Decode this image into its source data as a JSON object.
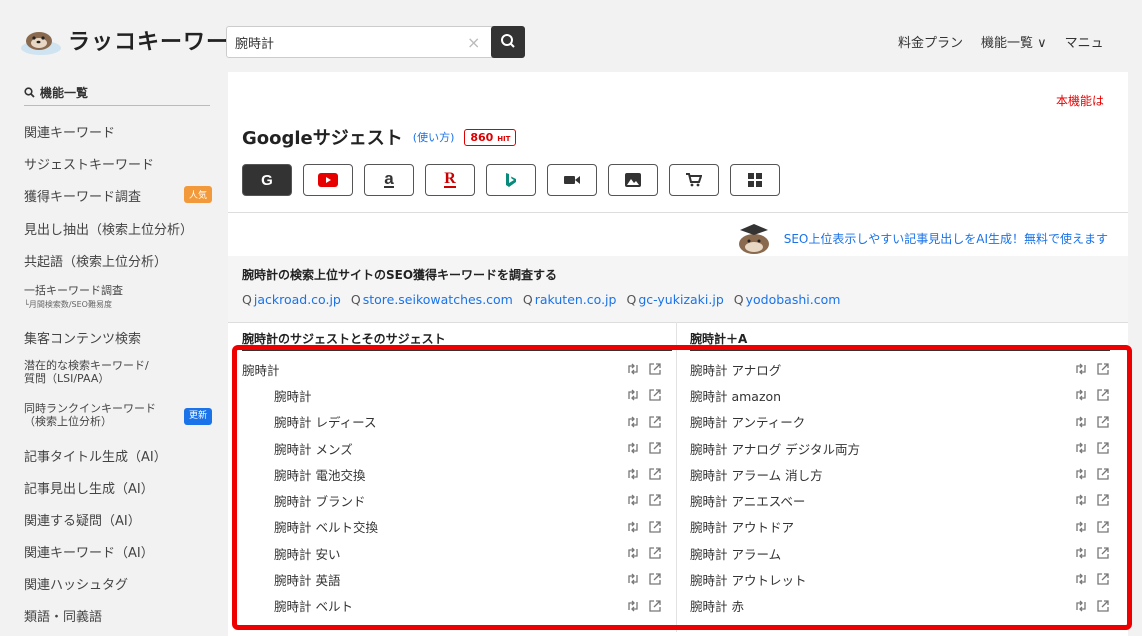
{
  "header": {
    "logo_text": "ラッコキーワード",
    "search_value": "腕時計",
    "nav": [
      "料金プラン",
      "機能一覧 ∨",
      "マニュ"
    ]
  },
  "sidebar": {
    "heading": "機能一覧",
    "items": [
      {
        "label": "関連キーワード"
      },
      {
        "label": "サジェストキーワード"
      },
      {
        "label": "獲得キーワード調査",
        "badge": "人気"
      },
      {
        "label": "見出し抽出（検索上位分析）"
      },
      {
        "label": "共起語（検索上位分析）"
      },
      {
        "label": "一括キーワード調査",
        "sub": "└月間検索数/SEO難易度"
      },
      {
        "label": "集客コンテンツ検索"
      },
      {
        "label": "潜在的な検索キーワード/",
        "sub2": "質問（LSI/PAA）"
      },
      {
        "label": "同時ランクインキーワード",
        "sub2": "（検索上位分析）",
        "badge": "更新"
      },
      {
        "label": "記事タイトル生成（AI）"
      },
      {
        "label": "記事見出し生成（AI）"
      },
      {
        "label": "関連する疑問（AI）"
      },
      {
        "label": "関連キーワード（AI）"
      },
      {
        "label": "関連ハッシュタグ"
      },
      {
        "label": "類語・同義語"
      }
    ]
  },
  "main": {
    "notice": "本機能は",
    "title": "Googleサジェスト",
    "usage_link": "(使い方)",
    "hit_count": "860",
    "hit_unit": "HIT",
    "engines": [
      "G",
      "youtube",
      "a",
      "R",
      "bing",
      "video",
      "image",
      "shopping",
      "windows"
    ],
    "promo_text": "SEO上位表示しやすい記事見出しをAI生成！無料で使えます",
    "seo_title": "腕時計の検索上位サイトのSEO獲得キーワードを調査する",
    "domains": [
      "jackroad.co.jp",
      "store.seikowatches.com",
      "rakuten.co.jp",
      "gc-yukizaki.jp",
      "yodobashi.com"
    ],
    "left_header": "腕時計のサジェストとそのサジェスト",
    "right_header": "腕時計＋A",
    "left_rows": [
      {
        "text": "腕時計",
        "indent": false
      },
      {
        "text": "腕時計",
        "indent": true
      },
      {
        "text": "腕時計 レディース",
        "indent": true
      },
      {
        "text": "腕時計 メンズ",
        "indent": true
      },
      {
        "text": "腕時計 電池交換",
        "indent": true
      },
      {
        "text": "腕時計 ブランド",
        "indent": true
      },
      {
        "text": "腕時計 ベルト交換",
        "indent": true
      },
      {
        "text": "腕時計 安い",
        "indent": true
      },
      {
        "text": "腕時計 英語",
        "indent": true
      },
      {
        "text": "腕時計 ベルト",
        "indent": true
      }
    ],
    "right_rows": [
      "腕時計 アナログ",
      "腕時計 amazon",
      "腕時計 アンティーク",
      "腕時計 アナログ デジタル両方",
      "腕時計 アラーム 消し方",
      "腕時計 アニエスベー",
      "腕時計 アウトドア",
      "腕時計 アラーム",
      "腕時計 アウトレット",
      "腕時計 赤"
    ]
  },
  "colors": {
    "accent": "#1a73e8",
    "highlight": "#ee0000",
    "badge_hot": "#f29a3b"
  }
}
